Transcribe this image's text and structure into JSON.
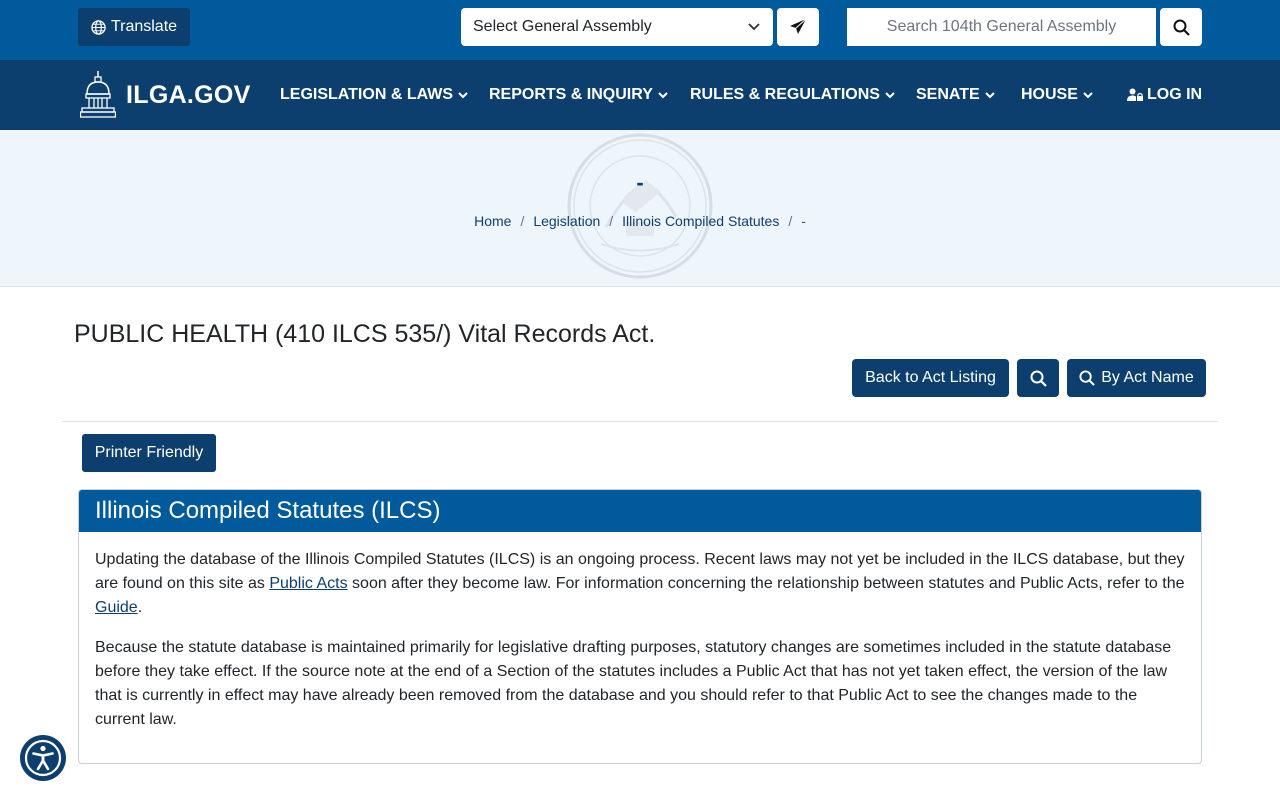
{
  "topbar": {
    "translate_label": "Translate",
    "assembly_select_value": "Select General Assembly",
    "search_placeholder": "Search 104th General Assembly"
  },
  "nav": {
    "logo_text": "ILGA.GOV",
    "items": [
      {
        "label": "LEGISLATION & LAWS"
      },
      {
        "label": "REPORTS & INQUIRY"
      },
      {
        "label": "RULES & REGULATIONS"
      },
      {
        "label": "SENATE"
      },
      {
        "label": "HOUSE"
      }
    ],
    "login_label": "LOG IN"
  },
  "hero": {
    "title": "-",
    "breadcrumbs": [
      "Home",
      "Legislation",
      "Illinois Compiled Statutes",
      "-"
    ]
  },
  "page": {
    "title": "PUBLIC HEALTH (410 ILCS 535/) Vital Records Act.",
    "back_label": "Back to Act Listing",
    "by_act_name_label": "By Act Name",
    "printer_label": "Printer Friendly"
  },
  "card": {
    "header": "Illinois Compiled Statutes (ILCS)",
    "p1_before": "Updating the database of the Illinois Compiled Statutes (ILCS) is an ongoing process. Recent laws may not yet be included in the ILCS database, but they are found on this site as ",
    "p1_link1": "Public Acts",
    "p1_middle": " soon after they become law. For information concerning the relationship between statutes and Public Acts, refer to the ",
    "p1_link2": "Guide",
    "p1_after": ".",
    "p2": "Because the statute database is maintained primarily for legislative drafting purposes, statutory changes are sometimes included in the statute database before they take effect. If the source note at the end of a Section of the statutes includes a Public Act that has not yet taken effect, the version of the law that is currently in effect may have already been removed from the database and you should refer to that Public Act to see the changes made to the current law."
  },
  "colors": {
    "topbar": "#005a9c",
    "navbar": "#0d3f6e",
    "hero_bg": "#eef5fb"
  },
  "icons": {
    "translate": "globe-icon",
    "select": "chevron-down-icon",
    "go": "paper-plane-icon",
    "search": "search-icon",
    "logo": "capitol-dome-icon",
    "login": "user-lock-icon",
    "accessibility": "accessibility-icon"
  }
}
